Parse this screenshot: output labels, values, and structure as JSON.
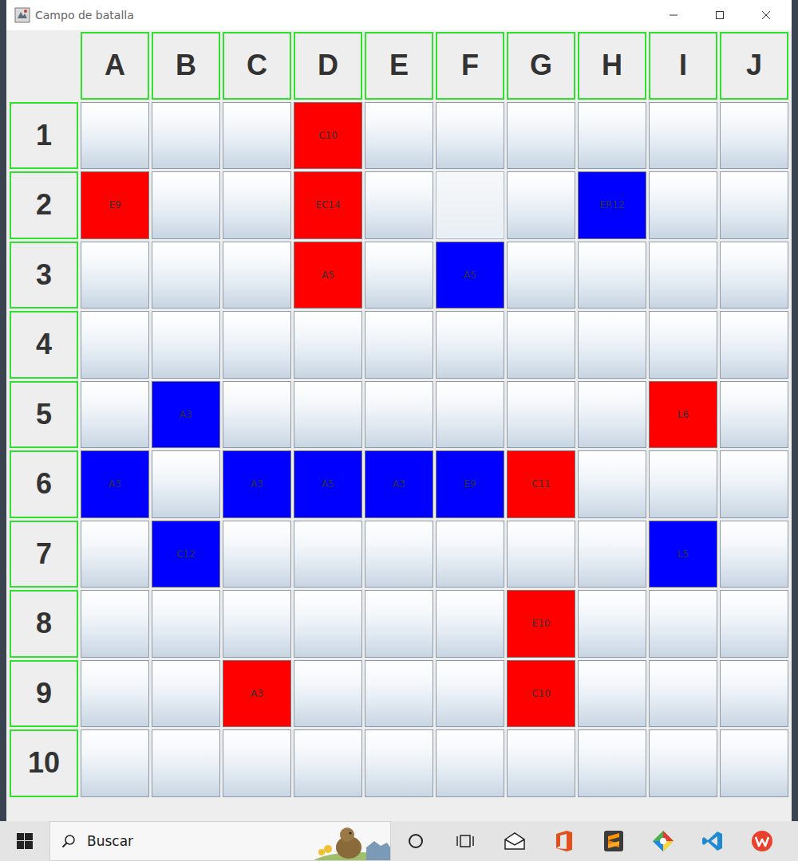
{
  "window": {
    "title": "Campo de batalla"
  },
  "board": {
    "columns": [
      "A",
      "B",
      "C",
      "D",
      "E",
      "F",
      "G",
      "H",
      "I",
      "J"
    ],
    "rows": [
      {
        "label": "1",
        "cells": [
          {
            "text": "",
            "selected": false
          },
          {
            "text": "",
            "selected": false
          },
          {
            "text": "",
            "selected": false
          },
          {
            "text": "C10",
            "color": "#ff0000",
            "selected": false
          },
          {
            "text": "",
            "selected": false
          },
          {
            "text": "",
            "selected": false
          },
          {
            "text": "",
            "selected": false
          },
          {
            "text": "",
            "selected": false
          },
          {
            "text": "",
            "selected": false
          },
          {
            "text": "",
            "selected": false
          }
        ]
      },
      {
        "label": "2",
        "cells": [
          {
            "text": "E9",
            "color": "#ff0000",
            "selected": false
          },
          {
            "text": "",
            "selected": false
          },
          {
            "text": "",
            "selected": false
          },
          {
            "text": "EC14",
            "color": "#ff0000",
            "selected": false
          },
          {
            "text": "",
            "selected": false
          },
          {
            "text": "",
            "selected": true
          },
          {
            "text": "",
            "selected": false
          },
          {
            "text": "ER12",
            "color": "#0000ff",
            "selected": false
          },
          {
            "text": "",
            "selected": false
          },
          {
            "text": "",
            "selected": false
          }
        ]
      },
      {
        "label": "3",
        "cells": [
          {
            "text": "",
            "selected": false
          },
          {
            "text": "",
            "selected": false
          },
          {
            "text": "",
            "selected": false
          },
          {
            "text": "A5",
            "color": "#ff0000",
            "selected": false
          },
          {
            "text": "",
            "selected": false
          },
          {
            "text": "A5",
            "color": "#0000ff",
            "selected": false
          },
          {
            "text": "",
            "selected": false
          },
          {
            "text": "",
            "selected": false
          },
          {
            "text": "",
            "selected": false
          },
          {
            "text": "",
            "selected": false
          }
        ]
      },
      {
        "label": "4",
        "cells": [
          {
            "text": "",
            "selected": false
          },
          {
            "text": "",
            "selected": false
          },
          {
            "text": "",
            "selected": false
          },
          {
            "text": "",
            "selected": false
          },
          {
            "text": "",
            "selected": false
          },
          {
            "text": "",
            "selected": false
          },
          {
            "text": "",
            "selected": false
          },
          {
            "text": "",
            "selected": false
          },
          {
            "text": "",
            "selected": false
          },
          {
            "text": "",
            "selected": false
          }
        ]
      },
      {
        "label": "5",
        "cells": [
          {
            "text": "",
            "selected": false
          },
          {
            "text": "A3",
            "color": "#0000ff",
            "selected": false
          },
          {
            "text": "",
            "selected": false
          },
          {
            "text": "",
            "selected": false
          },
          {
            "text": "",
            "selected": false
          },
          {
            "text": "",
            "selected": false
          },
          {
            "text": "",
            "selected": false
          },
          {
            "text": "",
            "selected": false
          },
          {
            "text": "L6",
            "color": "#ff0000",
            "selected": false
          },
          {
            "text": "",
            "selected": false
          }
        ]
      },
      {
        "label": "6",
        "cells": [
          {
            "text": "A3",
            "color": "#0000ff",
            "selected": false
          },
          {
            "text": "",
            "selected": false
          },
          {
            "text": "A3",
            "color": "#0000ff",
            "selected": false
          },
          {
            "text": "A5",
            "color": "#0000ff",
            "selected": false
          },
          {
            "text": "A3",
            "color": "#0000ff",
            "selected": false
          },
          {
            "text": "E9",
            "color": "#0000ff",
            "selected": false
          },
          {
            "text": "C11",
            "color": "#ff0000",
            "selected": false
          },
          {
            "text": "",
            "selected": false
          },
          {
            "text": "",
            "selected": false
          },
          {
            "text": "",
            "selected": false
          }
        ]
      },
      {
        "label": "7",
        "cells": [
          {
            "text": "",
            "selected": false
          },
          {
            "text": "C12",
            "color": "#0000ff",
            "selected": false
          },
          {
            "text": "",
            "selected": false
          },
          {
            "text": "",
            "selected": false
          },
          {
            "text": "",
            "selected": false
          },
          {
            "text": "",
            "selected": false
          },
          {
            "text": "",
            "selected": false
          },
          {
            "text": "",
            "selected": false
          },
          {
            "text": "L5",
            "color": "#0000ff",
            "selected": false
          },
          {
            "text": "",
            "selected": false
          }
        ]
      },
      {
        "label": "8",
        "cells": [
          {
            "text": "",
            "selected": false
          },
          {
            "text": "",
            "selected": false
          },
          {
            "text": "",
            "selected": false
          },
          {
            "text": "",
            "selected": false
          },
          {
            "text": "",
            "selected": false
          },
          {
            "text": "",
            "selected": false
          },
          {
            "text": "E10",
            "color": "#ff0000",
            "selected": false
          },
          {
            "text": "",
            "selected": false
          },
          {
            "text": "",
            "selected": false
          },
          {
            "text": "",
            "selected": false
          }
        ]
      },
      {
        "label": "9",
        "cells": [
          {
            "text": "",
            "selected": false
          },
          {
            "text": "",
            "selected": false
          },
          {
            "text": "A3",
            "color": "#ff0000",
            "selected": false
          },
          {
            "text": "",
            "selected": false
          },
          {
            "text": "",
            "selected": false
          },
          {
            "text": "",
            "selected": false
          },
          {
            "text": "C10",
            "color": "#ff0000",
            "selected": false
          },
          {
            "text": "",
            "selected": false
          },
          {
            "text": "",
            "selected": false
          },
          {
            "text": "",
            "selected": false
          }
        ]
      },
      {
        "label": "10",
        "cells": [
          {
            "text": "",
            "selected": false
          },
          {
            "text": "",
            "selected": false
          },
          {
            "text": "",
            "selected": false
          },
          {
            "text": "",
            "selected": false
          },
          {
            "text": "",
            "selected": false
          },
          {
            "text": "",
            "selected": false
          },
          {
            "text": "",
            "selected": false
          },
          {
            "text": "",
            "selected": false
          },
          {
            "text": "",
            "selected": false
          },
          {
            "text": "",
            "selected": false
          }
        ]
      }
    ]
  },
  "taskbar": {
    "search": {
      "placeholder": "Buscar"
    }
  }
}
